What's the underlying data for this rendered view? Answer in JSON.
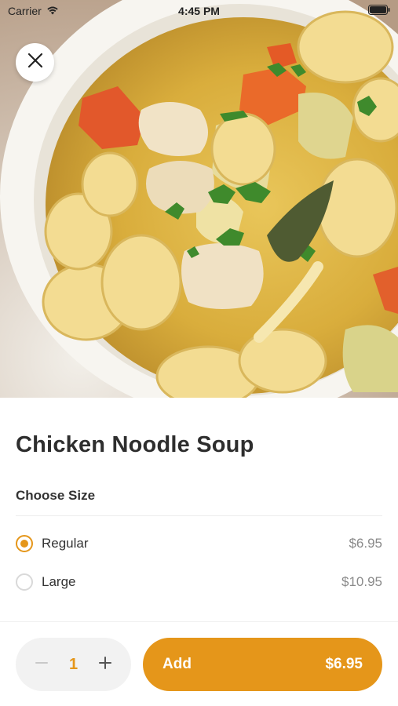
{
  "status_bar": {
    "carrier": "Carrier",
    "time": "4:45 PM"
  },
  "item": {
    "title": "Chicken Noodle Soup"
  },
  "size_section": {
    "label": "Choose Size",
    "options": [
      {
        "label": "Regular",
        "price": "$6.95",
        "selected": true
      },
      {
        "label": "Large",
        "price": "$10.95",
        "selected": false
      }
    ]
  },
  "footer": {
    "quantity": "1",
    "add_label": "Add",
    "add_price": "$6.95"
  },
  "colors": {
    "accent": "#E5961A",
    "text": "#2e2e2e",
    "muted": "#8a8a8a"
  },
  "icons": [
    "wifi-icon",
    "battery-icon",
    "close-icon",
    "minus-icon",
    "plus-icon",
    "radio-selected-icon",
    "radio-unselected-icon"
  ]
}
